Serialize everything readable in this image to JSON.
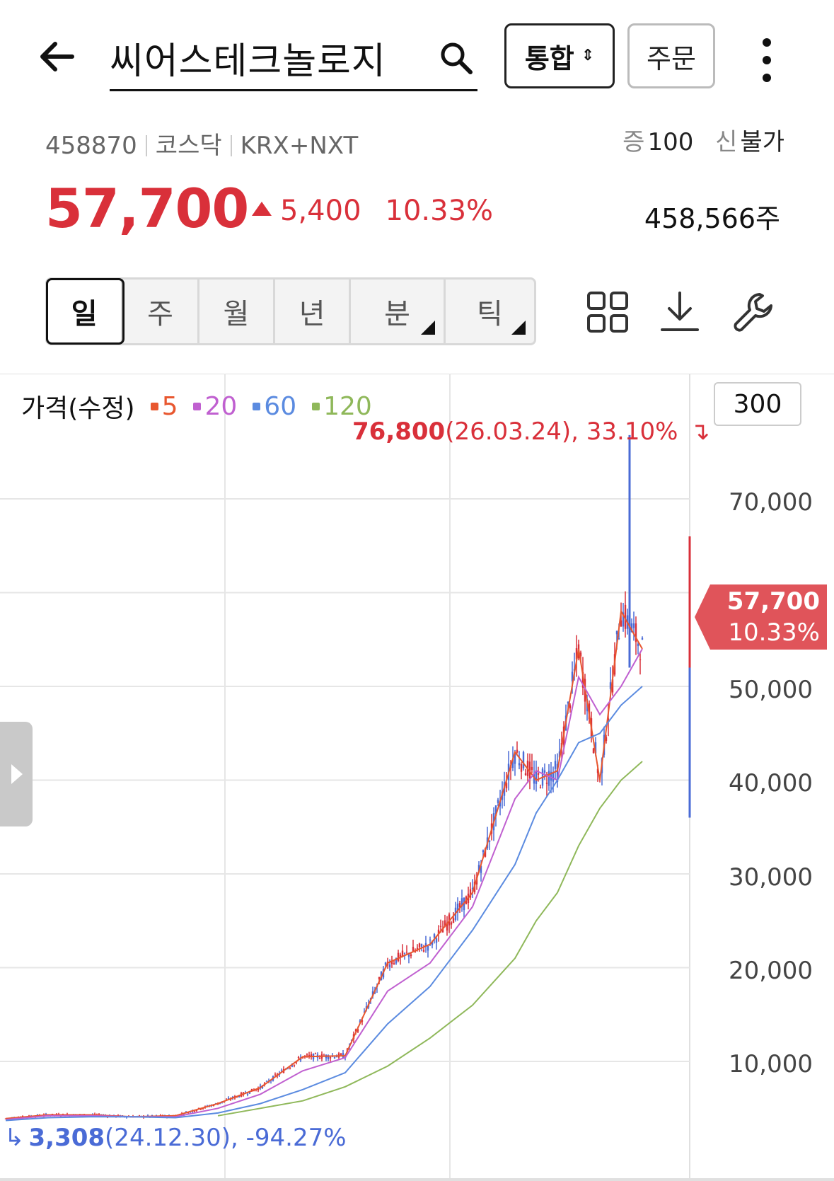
{
  "header": {
    "search_value": "씨어스테크놀로지",
    "unified_label": "통합",
    "unified_arrows": "⇕",
    "order_label": "주문"
  },
  "stock": {
    "code": "458870",
    "market": "코스닥",
    "exchange": "KRX+NXT",
    "margin_label": "증",
    "margin_value": "100",
    "credit_label": "신",
    "credit_value": "불가",
    "price": "57,700",
    "change": "5,400",
    "change_pct": "10.33%",
    "volume": "458,566주"
  },
  "period_tabs": [
    {
      "label": "일",
      "active": true
    },
    {
      "label": "주",
      "active": false
    },
    {
      "label": "월",
      "active": false
    },
    {
      "label": "년",
      "active": false
    },
    {
      "label": "분",
      "active": false
    },
    {
      "label": "틱",
      "active": false
    }
  ],
  "tools": [
    "grid-layout-icon",
    "download-icon",
    "wrench-icon"
  ],
  "chart": {
    "legend_title": "가격(수정)",
    "ma": [
      {
        "label": "5",
        "color": "#e8572f"
      },
      {
        "label": "20",
        "color": "#c060d0"
      },
      {
        "label": "60",
        "color": "#5b8be0"
      },
      {
        "label": "120",
        "color": "#8fb85a"
      }
    ],
    "range_value": "300",
    "high_value": "76,800",
    "high_detail": "(26.03.24), 33.10%",
    "high_arrow": "↴",
    "low_arrow": "↳",
    "low_value": "3,308",
    "low_detail": "(24.12.30), -94.27%",
    "current_price": "57,700",
    "current_pct": "10.33%",
    "y_labels": [
      "70,000",
      "50,000",
      "40,000",
      "30,000",
      "20,000",
      "10,000"
    ],
    "colors": {
      "up": "#d9303a",
      "down": "#4a6bd6",
      "grid": "#e6e6e6"
    }
  },
  "chart_data": {
    "type": "line",
    "title": "",
    "ylabel": "",
    "ylim": [
      0,
      80000
    ],
    "y_ticks": [
      10000,
      20000,
      30000,
      40000,
      50000,
      70000
    ],
    "x": [
      0,
      20,
      40,
      60,
      80,
      100,
      120,
      140,
      160,
      180,
      200,
      220,
      240,
      250,
      260,
      270,
      280,
      290,
      300
    ],
    "series": [
      {
        "name": "5",
        "values": [
          3900,
          4300,
          4300,
          4100,
          4200,
          5500,
          7200,
          10500,
          10600,
          20500,
          22500,
          28000,
          43000,
          40000,
          41000,
          54000,
          40000,
          58000,
          54000
        ]
      },
      {
        "name": "20",
        "values": [
          3800,
          4200,
          4200,
          4100,
          4100,
          5000,
          6500,
          9000,
          10400,
          17500,
          20500,
          26500,
          38000,
          41000,
          40000,
          51000,
          47000,
          50000,
          54000
        ]
      },
      {
        "name": "60",
        "values": [
          3700,
          4000,
          4100,
          4100,
          4000,
          4500,
          5500,
          7000,
          8800,
          14000,
          18000,
          24000,
          31000,
          36500,
          40000,
          44000,
          45000,
          48000,
          50000
        ]
      },
      {
        "name": "120",
        "values": [
          null,
          null,
          null,
          null,
          null,
          4200,
          5000,
          5800,
          7300,
          9500,
          12500,
          16000,
          21000,
          25000,
          28000,
          33000,
          37000,
          40000,
          42000
        ]
      }
    ],
    "annotations": [
      {
        "label": "high",
        "value": 76800,
        "date": "26.03.24"
      },
      {
        "label": "low",
        "value": 3308,
        "date": "24.12.30"
      }
    ]
  }
}
